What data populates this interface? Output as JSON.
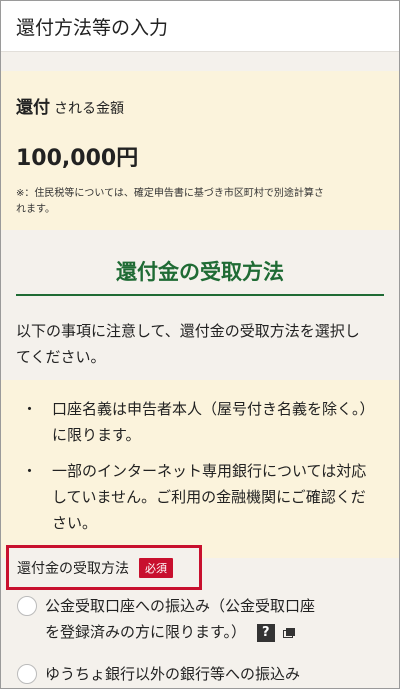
{
  "header": {
    "title": "還付方法等の入力"
  },
  "refund": {
    "label_bold": "還付",
    "label_rest": "される金額",
    "amount": "100,000円",
    "note_line1": "※：住民税等については、確定申告書に基づき市区町村で別途計算さ",
    "note_line2": "れます。"
  },
  "section": {
    "title": "還付金の受取方法",
    "desc_line1": "以下の事項に注意して、還付金の受取方法を選択し",
    "desc_line2": "てください。"
  },
  "notes": [
    {
      "bullet": "・",
      "line1": "口座名義は申告者本人（屋号付き名義を除く。）",
      "line2": "に限ります。",
      "line3": ""
    },
    {
      "bullet": "・",
      "line1": "一部のインターネット専用銀行については対応",
      "line2": "していません。ご利用の金融機関にご確認くだ",
      "line3": "さい。"
    }
  ],
  "method": {
    "label": "還付金の受取方法",
    "required": "必須"
  },
  "options": [
    {
      "line1": "公金受取口座への振込み（公金受取口座",
      "line2": "を登録済みの方に限ります。）",
      "help": "?"
    },
    {
      "line1": "ゆうちょ銀行以外の銀行等への振込み"
    }
  ],
  "icons": {
    "help": "question-icon",
    "external": "external-window-icon"
  },
  "colors": {
    "accent": "#1f6b34",
    "required": "#c8102e",
    "highlight_bg": "#fbf3dc"
  }
}
